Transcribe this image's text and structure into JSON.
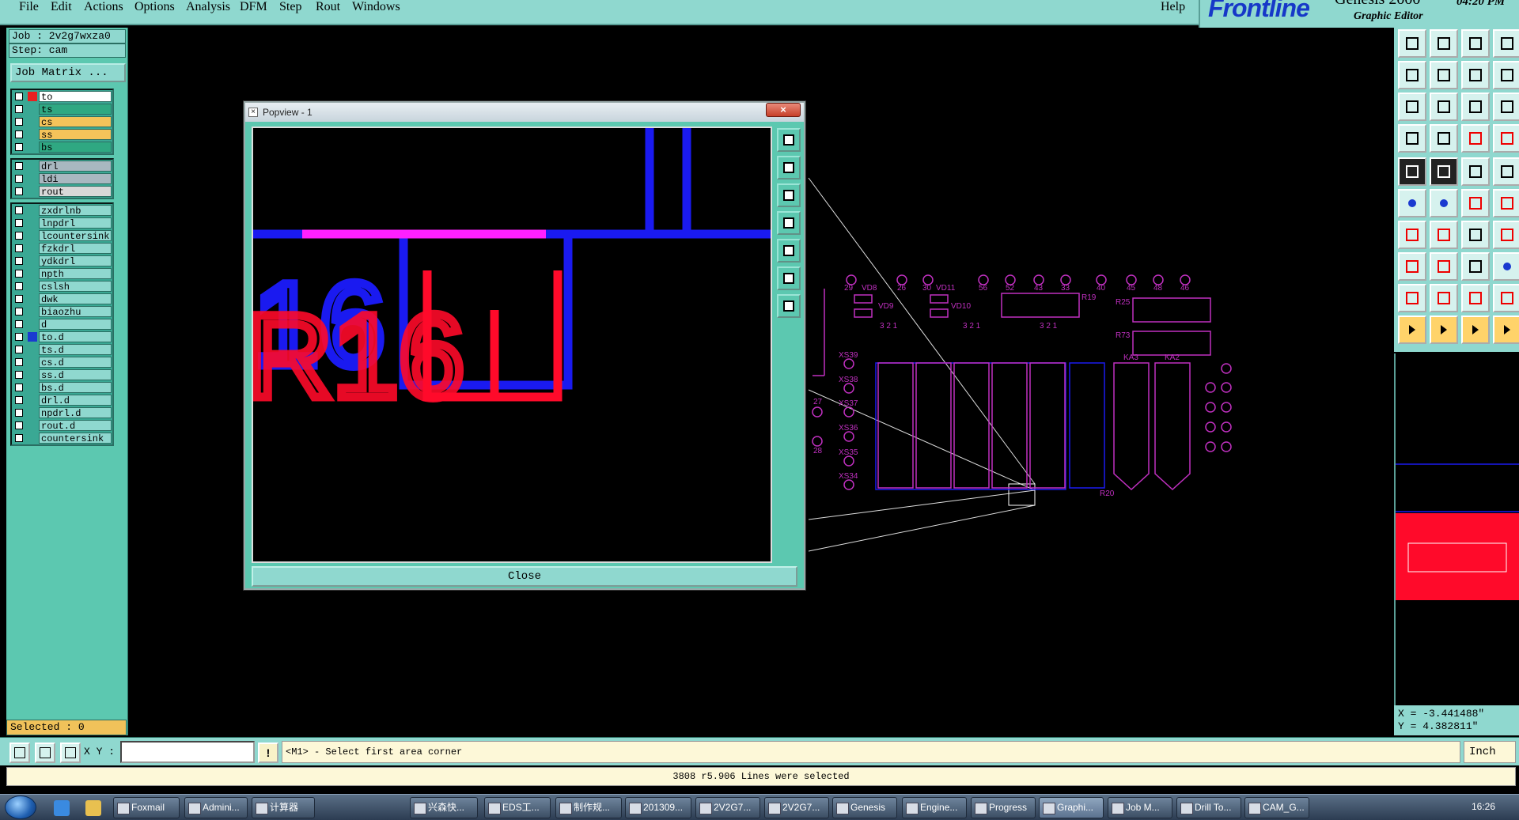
{
  "menu": [
    "File",
    "Edit",
    "Actions",
    "Options",
    "Analysis",
    "DFM",
    "Step",
    "Rout",
    "Windows"
  ],
  "help": "Help",
  "brand": {
    "logo": "Frontline",
    "product": "Genesis 2000",
    "subtitle": "Graphic Editor",
    "time": "04:20 PM"
  },
  "job": "Job : 2v2g7wxza0",
  "step": "Step: cam",
  "job_matrix": "Job Matrix ...",
  "layer_groups": [
    [
      {
        "name": "to",
        "swatch": "#e82020",
        "bg": "#ffffff"
      },
      {
        "name": "ts",
        "swatch": "",
        "bg": "#2fa882"
      },
      {
        "name": "cs",
        "swatch": "",
        "bg": "#f4c35a"
      },
      {
        "name": "ss",
        "swatch": "",
        "bg": "#f4c35a"
      },
      {
        "name": "bs",
        "swatch": "",
        "bg": "#2fa882"
      }
    ],
    [
      {
        "name": "drl",
        "swatch": "",
        "bg": "#a8b8c0"
      },
      {
        "name": "ldi",
        "swatch": "",
        "bg": "#a8b8c0"
      },
      {
        "name": "rout",
        "swatch": "",
        "bg": "#d8d8d8"
      }
    ],
    [
      {
        "name": "zxdrlnb",
        "swatch": "",
        "bg": "#8fd8cf"
      },
      {
        "name": "lnpdrl",
        "swatch": "",
        "bg": "#8fd8cf"
      },
      {
        "name": "lcountersink",
        "swatch": "",
        "bg": "#8fd8cf"
      },
      {
        "name": "fzkdrl",
        "swatch": "",
        "bg": "#8fd8cf"
      },
      {
        "name": "ydkdrl",
        "swatch": "",
        "bg": "#8fd8cf"
      },
      {
        "name": "npth",
        "swatch": "",
        "bg": "#8fd8cf"
      },
      {
        "name": "cslsh",
        "swatch": "",
        "bg": "#8fd8cf"
      },
      {
        "name": "dwk",
        "swatch": "",
        "bg": "#8fd8cf"
      },
      {
        "name": "biaozhu",
        "swatch": "",
        "bg": "#8fd8cf"
      },
      {
        "name": "d",
        "swatch": "",
        "bg": "#8fd8cf"
      },
      {
        "name": "to.d",
        "swatch": "#1a3ad0",
        "bg": "#8fd8cf"
      },
      {
        "name": "ts.d",
        "swatch": "",
        "bg": "#8fd8cf"
      },
      {
        "name": "cs.d",
        "swatch": "",
        "bg": "#8fd8cf"
      },
      {
        "name": "ss.d",
        "swatch": "",
        "bg": "#8fd8cf"
      },
      {
        "name": "bs.d",
        "swatch": "",
        "bg": "#8fd8cf"
      },
      {
        "name": "drl.d",
        "swatch": "",
        "bg": "#8fd8cf"
      },
      {
        "name": "npdrl.d",
        "swatch": "",
        "bg": "#8fd8cf"
      },
      {
        "name": "rout.d",
        "swatch": "",
        "bg": "#8fd8cf"
      },
      {
        "name": "countersink",
        "swatch": "",
        "bg": "#8fd8cf"
      }
    ]
  ],
  "selected": "Selected : 0",
  "popview": {
    "title": "Popview - 1",
    "close_x": "×",
    "close_label": "Close",
    "text_blue": "16",
    "text_red": "R16"
  },
  "board_labels": [
    {
      "t": "29"
    },
    {
      "t": "VD8"
    },
    {
      "t": "26"
    },
    {
      "t": "30"
    },
    {
      "t": "VD11"
    },
    {
      "t": "56"
    },
    {
      "t": "52"
    },
    {
      "t": "43"
    },
    {
      "t": "33"
    },
    {
      "t": "40"
    },
    {
      "t": "45"
    },
    {
      "t": "48"
    },
    {
      "t": "46"
    },
    {
      "t": "VD9"
    },
    {
      "t": "VD10"
    },
    {
      "t": "R19"
    },
    {
      "t": "R25"
    },
    {
      "t": "R73"
    },
    {
      "t": "XS39"
    },
    {
      "t": "XS38"
    },
    {
      "t": "XS37"
    },
    {
      "t": "XS36"
    },
    {
      "t": "XS35"
    },
    {
      "t": "XS34"
    },
    {
      "t": "27"
    },
    {
      "t": "28"
    },
    {
      "t": "KA3"
    },
    {
      "t": "KA2"
    },
    {
      "t": "R20"
    },
    {
      "t": "3 2 1"
    }
  ],
  "coords": {
    "x": "X = -3.441488\"",
    "y": "Y = 4.382811\""
  },
  "cmd": {
    "xy_label": "X Y :",
    "xy_value": "",
    "warn": "!",
    "prompt": "<M1> - Select first area corner",
    "units": "Inch"
  },
  "status": "3808 r5.906 Lines were selected",
  "taskbar": {
    "tasks": [
      "Foxmail",
      "Admini...",
      "计算器",
      "兴森快...",
      "EDS工...",
      "制作规...",
      "201309...",
      "2V2G7...",
      "2V2G7...",
      "Genesis",
      "Engine...",
      "Progress",
      "Graphi...",
      "Job M...",
      "Drill To...",
      "CAM_G..."
    ],
    "time": "16:26"
  },
  "colors": {
    "panel": "#5cc8b0",
    "menubar": "#8fd8cf",
    "trace_blue": "#1a1af0",
    "trace_red": "#ff0a2a",
    "silk": "#c030c0"
  }
}
